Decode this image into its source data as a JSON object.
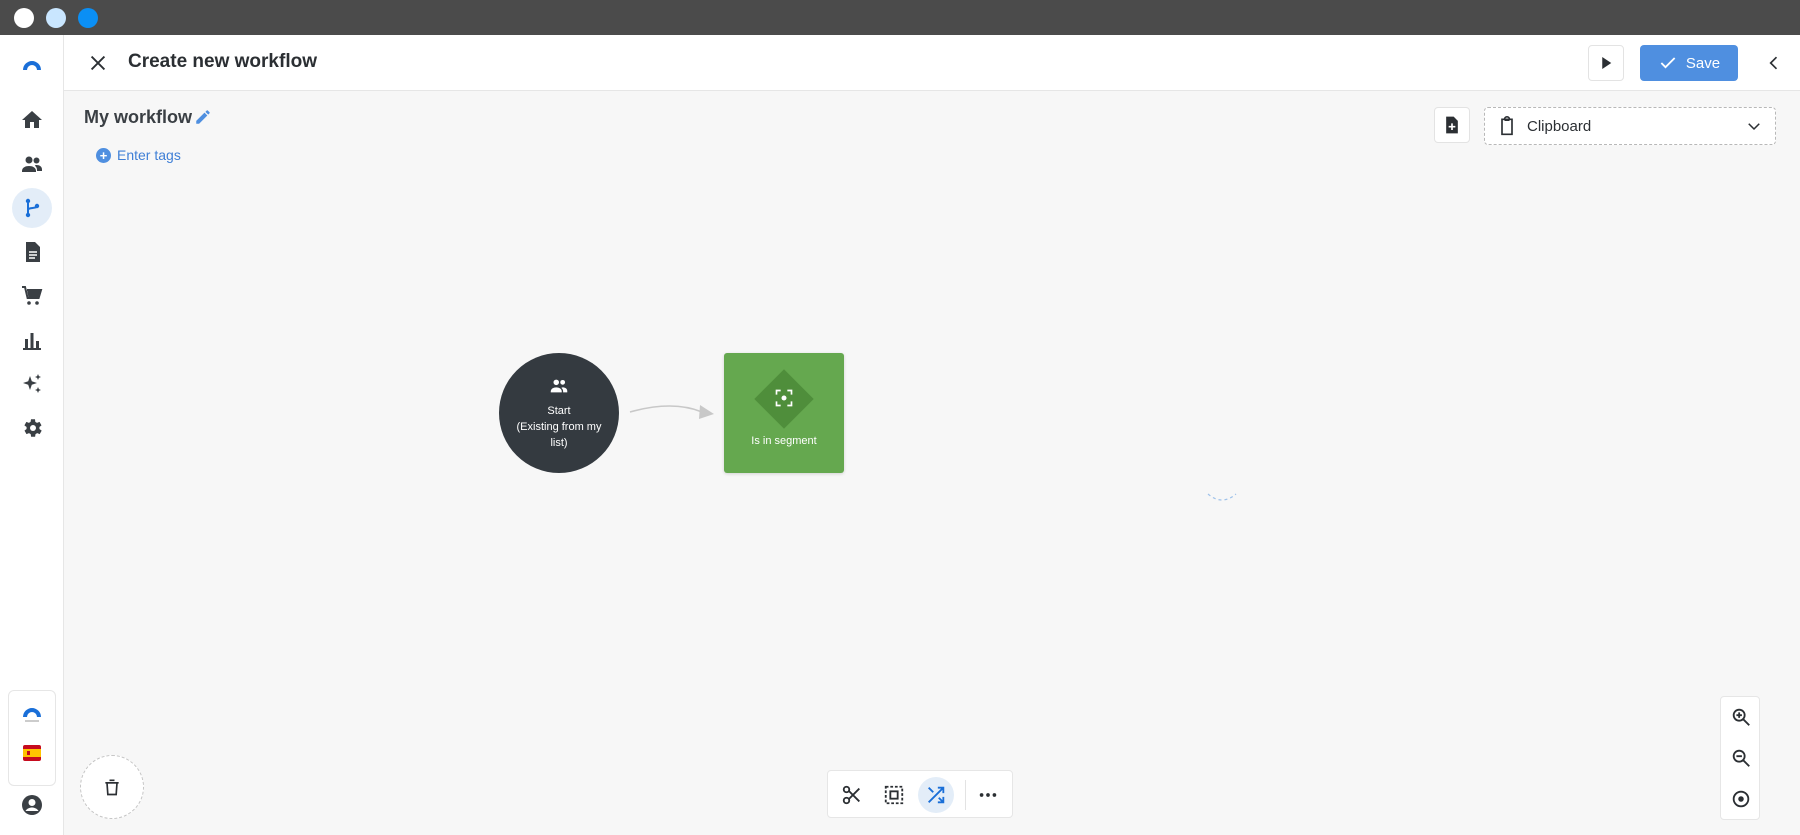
{
  "window": {
    "dots": [
      "#ffffff",
      "#c9e6ff",
      "#0b8ff5"
    ]
  },
  "header": {
    "title": "Create new workflow",
    "save_label": "Save"
  },
  "workflow": {
    "name": "My workflow",
    "tags_placeholder": "Enter tags"
  },
  "clipboard": {
    "label": "Clipboard"
  },
  "nodes": {
    "start": {
      "line1": "Start",
      "line2": "(Existing from my list)"
    },
    "segment": {
      "label": "Is in segment"
    }
  },
  "sidebar": {
    "items": [
      {
        "icon": "home-icon"
      },
      {
        "icon": "contacts-icon"
      },
      {
        "icon": "workflow-icon",
        "active": true
      },
      {
        "icon": "document-icon"
      },
      {
        "icon": "cart-icon"
      },
      {
        "icon": "chart-icon"
      },
      {
        "icon": "sparkle-icon"
      },
      {
        "icon": "gear-icon"
      }
    ]
  },
  "colors": {
    "accent": "#4f8fe0",
    "start_node": "#343a40",
    "segment_node": "#65a84f"
  }
}
